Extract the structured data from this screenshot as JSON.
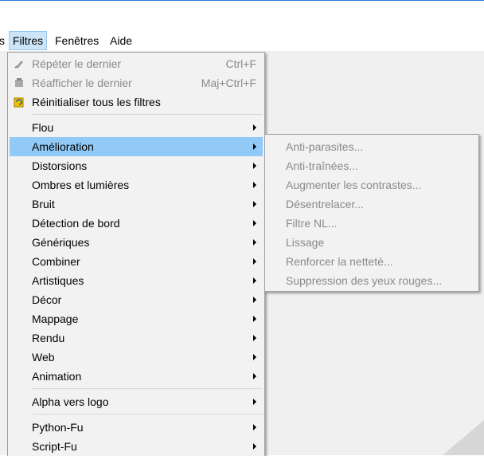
{
  "menubar": {
    "items": [
      {
        "label": "s"
      },
      {
        "label": "Filtres"
      },
      {
        "label": "Fenêtres"
      },
      {
        "label": "Aide"
      }
    ]
  },
  "filters_menu": {
    "items": [
      {
        "label": "Répéter le dernier",
        "shortcut": "Ctrl+F",
        "disabled": true,
        "icon": "repeat-icon"
      },
      {
        "label": "Réafficher le dernier",
        "shortcut": "Maj+Ctrl+F",
        "disabled": true,
        "icon": "reshow-icon"
      },
      {
        "label": "Réinitialiser tous les filtres",
        "icon": "reset-filters-icon"
      },
      {
        "label": "Flou",
        "submenu": true
      },
      {
        "label": "Amélioration",
        "submenu": true,
        "highlighted": true
      },
      {
        "label": "Distorsions",
        "submenu": true
      },
      {
        "label": "Ombres et lumières",
        "submenu": true
      },
      {
        "label": "Bruit",
        "submenu": true
      },
      {
        "label": "Détection de bord",
        "submenu": true
      },
      {
        "label": "Génériques",
        "submenu": true
      },
      {
        "label": "Combiner",
        "submenu": true
      },
      {
        "label": "Artistiques",
        "submenu": true
      },
      {
        "label": "Décor",
        "submenu": true
      },
      {
        "label": "Mappage",
        "submenu": true
      },
      {
        "label": "Rendu",
        "submenu": true
      },
      {
        "label": "Web",
        "submenu": true
      },
      {
        "label": "Animation",
        "submenu": true
      },
      {
        "label": "Alpha vers logo",
        "submenu": true
      },
      {
        "label": "Python-Fu",
        "submenu": true
      },
      {
        "label": "Script-Fu",
        "submenu": true
      }
    ]
  },
  "enhance_submenu": {
    "items": [
      {
        "label": "Anti-parasites..."
      },
      {
        "label": "Anti-traînées..."
      },
      {
        "label": "Augmenter les contrastes..."
      },
      {
        "label": "Désentrelacer..."
      },
      {
        "label": "Filtre NL..."
      },
      {
        "label": "Lissage"
      },
      {
        "label": "Renforcer la netteté..."
      },
      {
        "label": "Suppression des yeux rouges..."
      }
    ]
  }
}
